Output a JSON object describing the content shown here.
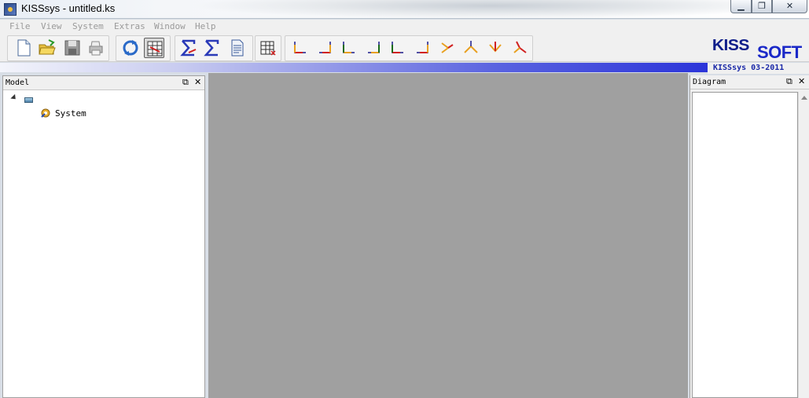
{
  "window": {
    "title": "KISSsys - untitled.ks",
    "minimize_glyph": "▁",
    "maximize_glyph": "❐",
    "close_glyph": "✕"
  },
  "menu": {
    "items": [
      "File",
      "View",
      "System",
      "Extras",
      "Window",
      "Help"
    ]
  },
  "toolbar": {
    "buttons": [
      {
        "name": "new-file",
        "icon": "new-document-icon"
      },
      {
        "name": "open-file",
        "icon": "open-folder-icon"
      },
      {
        "name": "save-file",
        "icon": "save-disk-icon"
      },
      {
        "name": "print",
        "icon": "printer-icon"
      },
      {
        "name": "refresh",
        "icon": "refresh-icon"
      },
      {
        "name": "calc-table",
        "icon": "table-calc-icon",
        "pressed": true
      },
      {
        "name": "sum-red",
        "icon": "sigma-red-icon"
      },
      {
        "name": "sum-blue",
        "icon": "sigma-blue-icon"
      },
      {
        "name": "report",
        "icon": "report-document-icon"
      },
      {
        "name": "table-view",
        "icon": "table-view-icon"
      },
      {
        "name": "view-xy",
        "icon": "axis-view-icon"
      },
      {
        "name": "view-yx",
        "icon": "axis-view-icon"
      },
      {
        "name": "view-zx",
        "icon": "axis-view-icon"
      },
      {
        "name": "view-zy",
        "icon": "axis-view-icon"
      },
      {
        "name": "view-yz",
        "icon": "axis-view-icon"
      },
      {
        "name": "view-xz",
        "icon": "axis-view-icon"
      },
      {
        "name": "view-iso1",
        "icon": "axis-view-icon"
      },
      {
        "name": "view-iso2",
        "icon": "axis-view-icon"
      },
      {
        "name": "view-iso3",
        "icon": "axis-view-icon"
      },
      {
        "name": "view-iso4",
        "icon": "axis-view-icon"
      }
    ]
  },
  "branding": {
    "logo_part1": "KISS",
    "logo_part2": "SOFT",
    "version": "KISSsys 03-2011",
    "brand_color": "#1a28c8"
  },
  "model_panel": {
    "title": "Model",
    "float_glyph": "⧉",
    "close_glyph": "✕",
    "tree": {
      "child_label": "System"
    }
  },
  "diagram_panel": {
    "title": "Diagram",
    "float_glyph": "⧉",
    "close_glyph": "✕"
  }
}
